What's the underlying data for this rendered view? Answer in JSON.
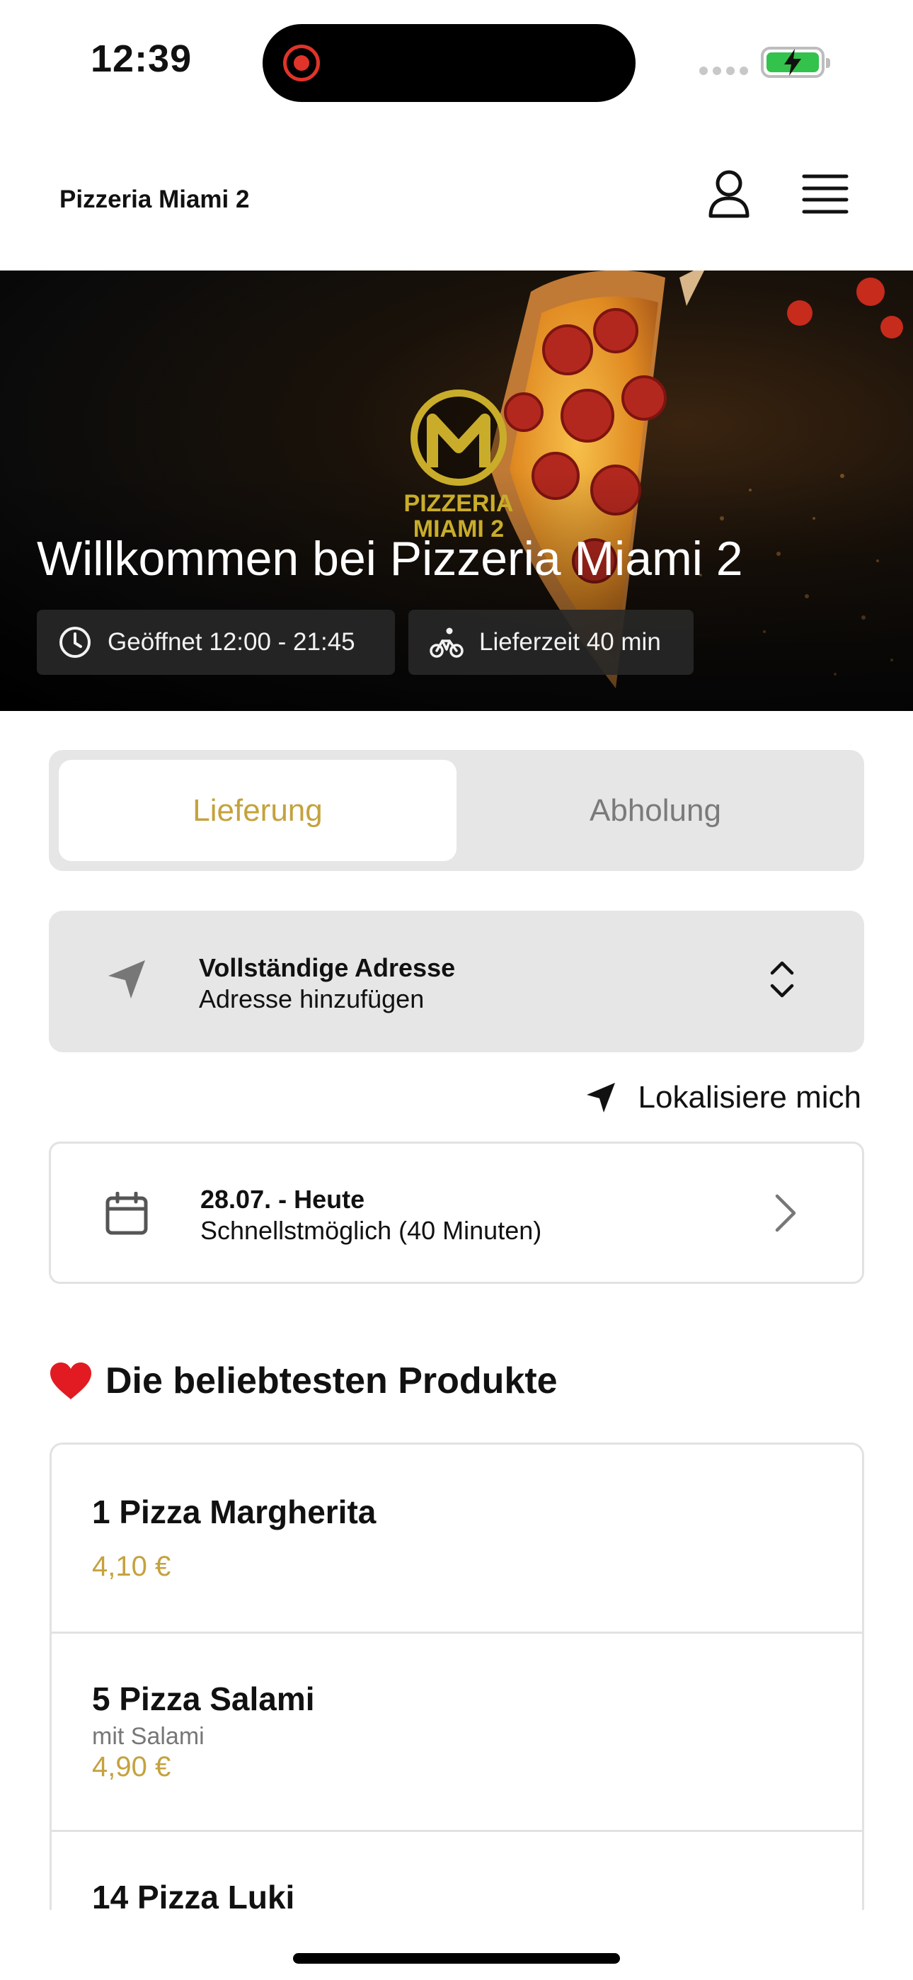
{
  "status_bar": {
    "time": "12:39"
  },
  "header": {
    "restaurant_name": "Pizzeria Miami 2"
  },
  "hero": {
    "logo_text": [
      "PIZZERIA",
      "MIAMI 2"
    ],
    "title": "Willkommen bei Pizzeria Miami 2",
    "opening_hours": "Geöffnet 12:00 - 21:45",
    "delivery_time": "Lieferzeit 40 min"
  },
  "order_mode": {
    "active": "Lieferung",
    "inactive": "Abholung"
  },
  "address": {
    "title": "Vollständige Adresse",
    "subtitle": "Adresse hinzufügen"
  },
  "locate_label": "Lokalisiere mich",
  "schedule": {
    "date": "28.07. - Heute",
    "time": "Schnellstmöglich (40 Minuten)"
  },
  "popular": {
    "title": "Die beliebtesten Produkte",
    "products": [
      {
        "name": "1 Pizza Margherita",
        "description": "",
        "price": "4,10 €"
      },
      {
        "name": "5 Pizza Salami",
        "description": "mit Salami",
        "price": "4,90 €"
      },
      {
        "name": "14 Pizza Luki",
        "description": "",
        "price": ""
      }
    ]
  },
  "colors": {
    "accent": "#c4a23e",
    "surface": "#e6e6e6",
    "border": "#e2e2e2",
    "chip": "#282828"
  }
}
